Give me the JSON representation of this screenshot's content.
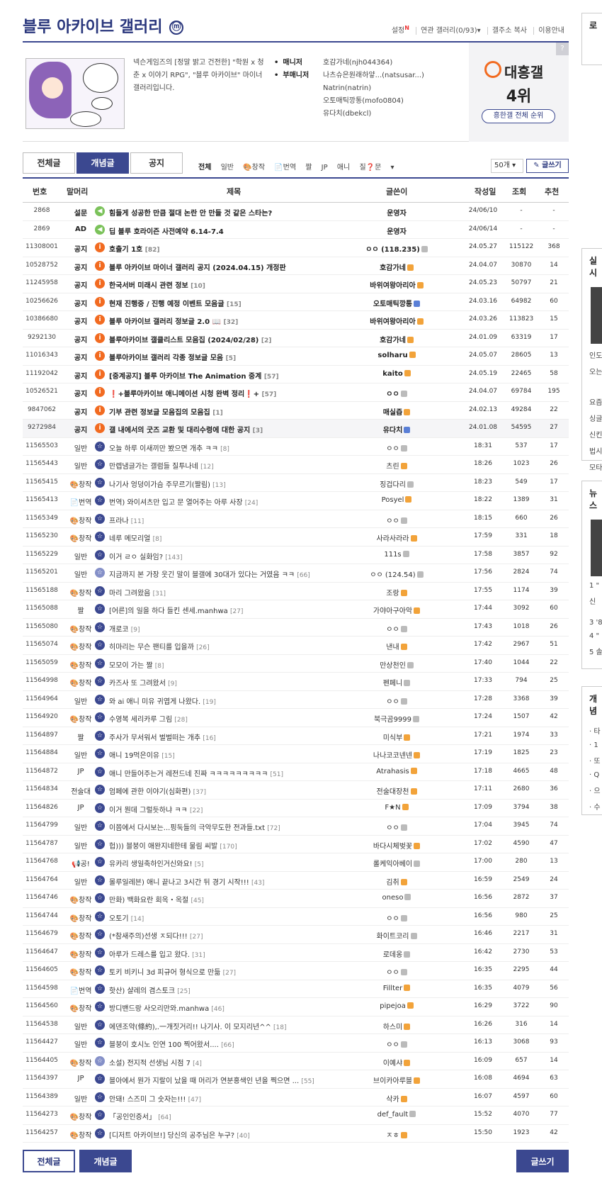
{
  "gallery": {
    "title": "블루 아카이브 갤러리",
    "badge": "ⓜ",
    "menu": [
      "설정",
      "연관 갤러리(0/93)▾",
      "갤주소 복사",
      "이용안내"
    ],
    "new_mark": "N",
    "description": "넥슨게임즈의 [정말 밝고 건전한] \"학원 x 청춘 x 이야기 RPG\", \"블루 아카이브\" 마이너 갤러리입니다.",
    "manager_label": "매니저",
    "submanager_label": "부매니저",
    "managers": [
      "호감가네(njh044364)",
      "나츠슈은원래하얗...(natsusar...)",
      "Natrin(natrin)",
      "오토매틱깡통(mofo0804)",
      "유다치(dbekcl)"
    ],
    "rank_title": "대흥갤",
    "rank_value": "4위",
    "rank_button": "흥한갤 전체 순위",
    "rank_help": "?"
  },
  "sidebar": {
    "box1_title": "로",
    "box2_title": "실시",
    "box2_lines": [
      "인도",
      "오는",
      "요즘",
      "싱글",
      "신킨",
      "법시",
      "모타"
    ],
    "box3_title": "뉴스",
    "box3_lines": [
      "1 \"",
      "신",
      "3 '8",
      "4 \"",
      "5 솔"
    ],
    "box4_title": "개념",
    "box4_lines": [
      "· 타",
      "· 1",
      "· 또",
      "· Q",
      "· 으",
      "· 수"
    ]
  },
  "tabs": [
    "전체글",
    "개념글",
    "공지"
  ],
  "heads": [
    "전체",
    "일반",
    "🎨창작",
    "📄번역",
    "짤",
    "JP",
    "애니",
    "질❓문",
    "▾"
  ],
  "list_size": "50개 ▾",
  "write_label": "✎ 글쓰기",
  "columns": [
    "번호",
    "말머리",
    "제목",
    "글쓴이",
    "작성일",
    "조회",
    "추천"
  ],
  "rows": [
    {
      "num": "2868",
      "head": "설문",
      "icon": "s",
      "title": "힘들게 성공한 만큼 절대 논란 안 만들 것 같은 스타는?",
      "cm": "",
      "writer": "운영자",
      "badge": "",
      "date": "24/06/10",
      "view": "-",
      "rec": "-",
      "bold": true
    },
    {
      "num": "2869",
      "head": "AD",
      "icon": "s",
      "title": "딥 블루 호라이즌 사전예약 6.14-7.4",
      "cm": "",
      "writer": "운영자",
      "badge": "",
      "date": "24/06/14",
      "view": "-",
      "rec": "-",
      "bold": true
    },
    {
      "num": "11308001",
      "head": "공지",
      "icon": "n",
      "title": "호출기 1호",
      "cm": "[82]",
      "writer": "ㅇㅇ (118.235)",
      "badge": "",
      "date": "24.05.27",
      "view": "115122",
      "rec": "368",
      "bold": true
    },
    {
      "num": "10528752",
      "head": "공지",
      "icon": "n",
      "title": "블루 아카이브 마이너 갤러리 공지 (2024.04.15) 개정판",
      "cm": "",
      "writer": "호감가네",
      "badge": "o",
      "date": "24.04.07",
      "view": "30870",
      "rec": "14",
      "bold": true
    },
    {
      "num": "11245958",
      "head": "공지",
      "icon": "n",
      "title": "한국서버 미래시 관련 정보",
      "cm": "[10]",
      "writer": "바위여왕아리아",
      "badge": "o",
      "date": "24.05.23",
      "view": "50797",
      "rec": "21",
      "bold": true
    },
    {
      "num": "10256626",
      "head": "공지",
      "icon": "n",
      "title": "현재 진행중 / 진행 예정 이벤트 모음글",
      "cm": "[15]",
      "writer": "오토매틱깡통",
      "badge": "b",
      "date": "24.03.16",
      "view": "64982",
      "rec": "60",
      "bold": true
    },
    {
      "num": "10386680",
      "head": "공지",
      "icon": "n",
      "title": "블루 아카이브 갤러리 정보글 2.0 📖",
      "cm": "[32]",
      "writer": "바위여왕아리아",
      "badge": "o",
      "date": "24.03.26",
      "view": "113823",
      "rec": "15",
      "bold": true
    },
    {
      "num": "9292130",
      "head": "공지",
      "icon": "n",
      "title": "블루아카이브 갤클리스트 모음집 (2024/02/28)",
      "cm": "[2]",
      "writer": "호감가네",
      "badge": "o",
      "date": "24.01.09",
      "view": "63319",
      "rec": "17",
      "bold": true
    },
    {
      "num": "11016343",
      "head": "공지",
      "icon": "n",
      "title": "블루아카이브 갤러리 각종 정보글 모음",
      "cm": "[5]",
      "writer": "solharu",
      "badge": "o",
      "date": "24.05.07",
      "view": "28605",
      "rec": "13",
      "bold": true
    },
    {
      "num": "11192042",
      "head": "공지",
      "icon": "n",
      "title": "[중계공지] 블루 아카이브 The Animation 중계",
      "cm": "[57]",
      "writer": "kaito",
      "badge": "o",
      "date": "24.05.19",
      "view": "22465",
      "rec": "58",
      "bold": true
    },
    {
      "num": "10526521",
      "head": "공지",
      "icon": "n",
      "title": "❗+블루아카이브 애니메이션 시청 완벽 정리❗+",
      "cm": "[57]",
      "writer": "ㅇㅇ",
      "badge": "",
      "date": "24.04.07",
      "view": "69784",
      "rec": "195",
      "bold": true
    },
    {
      "num": "9847062",
      "head": "공지",
      "icon": "n",
      "title": "기부 관련 정보글 모음집의 모음집",
      "cm": "[1]",
      "writer": "매실즙",
      "badge": "o",
      "date": "24.02.13",
      "view": "49284",
      "rec": "22",
      "bold": true
    },
    {
      "num": "9272984",
      "head": "공지",
      "icon": "n",
      "title": "갤 내에서의 굿즈 교환 및 대리수령에 대한 공지",
      "cm": "[3]",
      "writer": "유다치",
      "badge": "b",
      "date": "24.01.08",
      "view": "54595",
      "rec": "27",
      "bold": true,
      "hl": true
    },
    {
      "num": "11565503",
      "head": "일반",
      "icon": "p",
      "title": "오늘 하루 이새끼만 봤으면 개추 ㅋㅋ",
      "cm": "[8]",
      "writer": "ㅇㅇ",
      "badge": "",
      "date": "18:31",
      "view": "537",
      "rec": "17"
    },
    {
      "num": "11565443",
      "head": "일반",
      "icon": "p",
      "title": "만렙냄글가는 갤럼들 질투나네",
      "cm": "[12]",
      "writer": "츠린",
      "badge": "o",
      "date": "18:26",
      "view": "1023",
      "rec": "26"
    },
    {
      "num": "11565415",
      "head": "🎨창작",
      "icon": "p",
      "title": "나기사 엉덩이가슴 주무르기(짤림)",
      "cm": "[13]",
      "writer": "징겁다리",
      "badge": "",
      "date": "18:23",
      "view": "549",
      "rec": "17"
    },
    {
      "num": "11565413",
      "head": "📄번역",
      "icon": "p",
      "title": "번역) 와이셔츠만 입고 문 열어주는 아루 사장",
      "cm": "[24]",
      "writer": "Posyel",
      "badge": "o",
      "date": "18:22",
      "view": "1389",
      "rec": "31"
    },
    {
      "num": "11565349",
      "head": "🎨창작",
      "icon": "p",
      "title": "프라나",
      "cm": "[11]",
      "writer": "ㅇㅇ",
      "badge": "",
      "date": "18:15",
      "view": "660",
      "rec": "26"
    },
    {
      "num": "11565230",
      "head": "🎨창작",
      "icon": "p",
      "title": "네루 메모리얼",
      "cm": "[8]",
      "writer": "사라사라라",
      "badge": "o",
      "date": "17:59",
      "view": "331",
      "rec": "18"
    },
    {
      "num": "11565229",
      "head": "일반",
      "icon": "p",
      "title": "이거 ㄹㅇ 실화임?",
      "cm": "[143]",
      "writer": "111s",
      "badge": "",
      "date": "17:58",
      "view": "3857",
      "rec": "92"
    },
    {
      "num": "11565201",
      "head": "일반",
      "icon": "p2",
      "title": "지금까지 본 가장 웃긴 말이 블갤에 30대가 있다는 거였음 ㅋㅋ",
      "cm": "[66]",
      "writer": "ㅇㅇ (124.54)",
      "badge": "",
      "date": "17:56",
      "view": "2824",
      "rec": "74"
    },
    {
      "num": "11565188",
      "head": "🎨창작",
      "icon": "p",
      "title": "마리 그려왔음",
      "cm": "[31]",
      "writer": "조랑",
      "badge": "o",
      "date": "17:55",
      "view": "1174",
      "rec": "39"
    },
    {
      "num": "11565088",
      "head": "짤",
      "icon": "p",
      "title": "[어른]의 일을 하다 들킨 센세.manhwa",
      "cm": "[27]",
      "writer": "가야아구아악",
      "badge": "o",
      "date": "17:44",
      "view": "3092",
      "rec": "60"
    },
    {
      "num": "11565080",
      "head": "🎨창작",
      "icon": "p",
      "title": "개로코",
      "cm": "[9]",
      "writer": "ㅇㅇ",
      "badge": "",
      "date": "17:43",
      "view": "1018",
      "rec": "26"
    },
    {
      "num": "11565074",
      "head": "🎨창작",
      "icon": "p",
      "title": "히마리는 무슨 팬티를 입을까",
      "cm": "[26]",
      "writer": "낸내",
      "badge": "o",
      "date": "17:42",
      "view": "2967",
      "rec": "51"
    },
    {
      "num": "11565059",
      "head": "🎨창작",
      "icon": "p",
      "title": "모모이 가는 짤",
      "cm": "[8]",
      "writer": "만상천인",
      "badge": "",
      "date": "17:40",
      "view": "1044",
      "rec": "22"
    },
    {
      "num": "11564998",
      "head": "🎨창작",
      "icon": "p",
      "title": "카즈사 또 그려왔서",
      "cm": "[9]",
      "writer": "펜페니",
      "badge": "",
      "date": "17:33",
      "view": "794",
      "rec": "25"
    },
    {
      "num": "11564964",
      "head": "일반",
      "icon": "p",
      "title": "와 ai 애니 미유 귀엽게 나왔다.",
      "cm": "[19]",
      "writer": "ㅇㅇ",
      "badge": "",
      "date": "17:28",
      "view": "3368",
      "rec": "39"
    },
    {
      "num": "11564920",
      "head": "🎨창작",
      "icon": "p",
      "title": "수영복 세리카루 그림",
      "cm": "[28]",
      "writer": "북극곰9999",
      "badge": "",
      "date": "17:24",
      "view": "1507",
      "rec": "42"
    },
    {
      "num": "11564897",
      "head": "짤",
      "icon": "p",
      "title": "주사가 무서워서 벌벌떠는 개추",
      "cm": "[16]",
      "writer": "미식부",
      "badge": "o",
      "date": "17:21",
      "view": "1974",
      "rec": "33"
    },
    {
      "num": "11564884",
      "head": "일반",
      "icon": "p",
      "title": "애니 19먹은이유",
      "cm": "[15]",
      "writer": "나나코코넨넨",
      "badge": "o",
      "date": "17:19",
      "view": "1825",
      "rec": "23"
    },
    {
      "num": "11564872",
      "head": "JP",
      "icon": "p",
      "title": "애니 만들어주는거 레전드네 진짜 ㅋㅋㅋㅋㅋㅋㅋㅋㅋ",
      "cm": "[51]",
      "writer": "Atrahasis",
      "badge": "o",
      "date": "17:18",
      "view": "4665",
      "rec": "48"
    },
    {
      "num": "11564834",
      "head": "전술대",
      "icon": "p",
      "title": "엄페에 관한 이야기(심화편)",
      "cm": "[37]",
      "writer": "전술대장천",
      "badge": "o",
      "date": "17:11",
      "view": "2680",
      "rec": "36"
    },
    {
      "num": "11564826",
      "head": "JP",
      "icon": "p",
      "title": "이거 뭔데 그럴듯하냐 ㅋㅋ",
      "cm": "[22]",
      "writer": "F★N",
      "badge": "o",
      "date": "17:09",
      "view": "3794",
      "rec": "38"
    },
    {
      "num": "11564799",
      "head": "일반",
      "icon": "p",
      "title": "이쯤에서 다시보는...핑둑들의 극악무도한 전과들.txt",
      "cm": "[72]",
      "writer": "ㅇㅇ",
      "badge": "",
      "date": "17:04",
      "view": "3945",
      "rec": "74"
    },
    {
      "num": "11564787",
      "head": "일반",
      "icon": "p",
      "title": "헙))) 블붕이 애완지네한테 물림 씨발",
      "cm": "[170]",
      "writer": "바다시체벚꽃",
      "badge": "o",
      "date": "17:02",
      "view": "4590",
      "rec": "47"
    },
    {
      "num": "11564768",
      "head": "📢공!",
      "icon": "p",
      "title": "유카리 생일축하인거신와요!",
      "cm": "[5]",
      "writer": "롤케익아베이",
      "badge": "",
      "date": "17:00",
      "view": "280",
      "rec": "13"
    },
    {
      "num": "11564764",
      "head": "일반",
      "icon": "p",
      "title": "몰루일레븐) 애니 끝나고 3시간 뒤 경기 시작!!!",
      "cm": "[43]",
      "writer": "김취",
      "badge": "o",
      "date": "16:59",
      "view": "2549",
      "rec": "24"
    },
    {
      "num": "11564746",
      "head": "🎨창작",
      "icon": "p",
      "title": "만화) 백화요란 회옥・옥절",
      "cm": "[45]",
      "writer": "oneso",
      "badge": "",
      "date": "16:56",
      "view": "2872",
      "rec": "37"
    },
    {
      "num": "11564744",
      "head": "🎨창작",
      "icon": "p",
      "title": "오토기",
      "cm": "[14]",
      "writer": "ㅇㅇ",
      "badge": "",
      "date": "16:56",
      "view": "980",
      "rec": "25"
    },
    {
      "num": "11564679",
      "head": "🎨창작",
      "icon": "p",
      "title": "(*참새주의)선생 ㅈ되다!!!",
      "cm": "[27]",
      "writer": "화이트코리",
      "badge": "",
      "date": "16:46",
      "view": "2217",
      "rec": "31"
    },
    {
      "num": "11564647",
      "head": "🎨창작",
      "icon": "p",
      "title": "아루가 드레스를 입고 왔다.",
      "cm": "[31]",
      "writer": "로데옹",
      "badge": "",
      "date": "16:42",
      "view": "2730",
      "rec": "53"
    },
    {
      "num": "11564605",
      "head": "🎨창작",
      "icon": "p",
      "title": "토키 비키니 3d 피규어 형식으로 만듦",
      "cm": "[27]",
      "writer": "ㅇㅇ",
      "badge": "",
      "date": "16:35",
      "view": "2295",
      "rec": "44"
    },
    {
      "num": "11564598",
      "head": "📄번역",
      "icon": "p",
      "title": "핫산) 샬레의 겸스토크",
      "cm": "[25]",
      "writer": "Fillter",
      "badge": "o",
      "date": "16:35",
      "view": "4079",
      "rec": "56"
    },
    {
      "num": "11564560",
      "head": "🎨창작",
      "icon": "p",
      "title": "방디밴드랑 사오리만와.manhwa",
      "cm": "[46]",
      "writer": "pipejoa",
      "badge": "o",
      "date": "16:29",
      "view": "3722",
      "rec": "90"
    },
    {
      "num": "11564538",
      "head": "일반",
      "icon": "p",
      "title": "에덴조약(條約),.一개짓거리!! 나기사. 이 모지리년^^",
      "cm": "[18]",
      "writer": "하스미",
      "badge": "o",
      "date": "16:26",
      "view": "316",
      "rec": "14"
    },
    {
      "num": "11564427",
      "head": "일반",
      "icon": "p",
      "title": "블붕이 호시노 인연 100 찍어왔서....",
      "cm": "[66]",
      "writer": "ㅇㅇ",
      "badge": "",
      "date": "16:13",
      "view": "3068",
      "rec": "93"
    },
    {
      "num": "11564405",
      "head": "🎨창작",
      "icon": "p2",
      "title": "소설) 전지적 선생님 시점 7",
      "cm": "[4]",
      "writer": "이예샤",
      "badge": "o",
      "date": "16:09",
      "view": "657",
      "rec": "14"
    },
    {
      "num": "11564397",
      "head": "JP",
      "icon": "p",
      "title": "블아에서 뭔가 지랄이 났을 때 머리가 연분홍색인 년을 찍으면 ...",
      "cm": "[55]",
      "writer": "브이카아루블",
      "badge": "o",
      "date": "16:08",
      "view": "4694",
      "rec": "63"
    },
    {
      "num": "11564389",
      "head": "일반",
      "icon": "p",
      "title": "안돼! 스즈미 그 숫자는!!!",
      "cm": "[47]",
      "writer": "삭카",
      "badge": "o",
      "date": "16:07",
      "view": "4597",
      "rec": "60"
    },
    {
      "num": "11564273",
      "head": "🎨창작",
      "icon": "p",
      "title": "「공인인증서」",
      "cm": "[64]",
      "writer": "def_fault",
      "badge": "",
      "date": "15:52",
      "view": "4070",
      "rec": "77"
    },
    {
      "num": "11564257",
      "head": "🎨창작",
      "icon": "p",
      "title": "[디저트 아카이브!] 당신의 공주님은 누구?",
      "cm": "[40]",
      "writer": "ㅈㅎ",
      "badge": "o",
      "date": "15:50",
      "view": "1923",
      "rec": "42"
    }
  ],
  "bottom": {
    "all": "전체글",
    "best": "개념글",
    "write": "글쓰기"
  }
}
